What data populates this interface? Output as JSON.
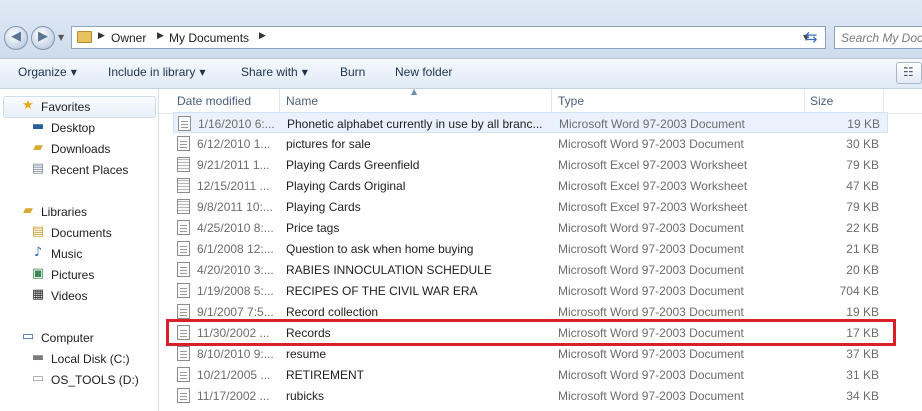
{
  "address_bar": {
    "breadcrumb": [
      "Owner",
      "My Documents"
    ],
    "search_placeholder": "Search My Documents"
  },
  "toolbar": {
    "organize": "Organize",
    "include_in_library": "Include in library",
    "share_with": "Share with",
    "burn": "Burn",
    "new_folder": "New folder"
  },
  "nav": {
    "favorites": {
      "header": "Favorites",
      "items": [
        "Desktop",
        "Downloads",
        "Recent Places"
      ]
    },
    "libraries": {
      "header": "Libraries",
      "items": [
        "Documents",
        "Music",
        "Pictures",
        "Videos"
      ]
    },
    "computer": {
      "header": "Computer",
      "items": [
        "Local Disk (C:)",
        "OS_TOOLS (D:)"
      ]
    }
  },
  "columns": [
    "Date modified",
    "Name",
    "Type",
    "Size"
  ],
  "files": [
    {
      "date": "1/16/2010 6:...",
      "name": "Phonetic alphabet currently in use by all branc...",
      "type": "Microsoft Word 97-2003 Document",
      "size": "19 KB",
      "icon": "word-doc-icon"
    },
    {
      "date": "6/12/2010 1...",
      "name": "pictures for sale",
      "type": "Microsoft Word 97-2003 Document",
      "size": "30 KB",
      "icon": "word-doc-icon"
    },
    {
      "date": "9/21/2011 1...",
      "name": "Playing Cards Greenfield",
      "type": "Microsoft Excel 97-2003 Worksheet",
      "size": "79 KB",
      "icon": "excel-sheet-icon"
    },
    {
      "date": "12/15/2011 ...",
      "name": "Playing Cards Original",
      "type": "Microsoft Excel 97-2003 Worksheet",
      "size": "47 KB",
      "icon": "excel-sheet-icon"
    },
    {
      "date": "9/8/2011 10:...",
      "name": "Playing Cards",
      "type": "Microsoft Excel 97-2003 Worksheet",
      "size": "79 KB",
      "icon": "excel-sheet-icon"
    },
    {
      "date": "4/25/2010 8:...",
      "name": "Price tags",
      "type": "Microsoft Word 97-2003 Document",
      "size": "22 KB",
      "icon": "word-doc-icon"
    },
    {
      "date": "6/1/2008 12:...",
      "name": "Question to ask when home buying",
      "type": "Microsoft Word 97-2003 Document",
      "size": "21 KB",
      "icon": "word-doc-icon"
    },
    {
      "date": "4/20/2010 3:...",
      "name": "RABIES INNOCULATION SCHEDULE",
      "type": "Microsoft Word 97-2003 Document",
      "size": "20 KB",
      "icon": "word-doc-icon"
    },
    {
      "date": "1/19/2008 5:...",
      "name": "RECIPES OF THE CIVIL WAR ERA",
      "type": "Microsoft Word 97-2003 Document",
      "size": "704 KB",
      "icon": "word-doc-icon"
    },
    {
      "date": "9/1/2007 7:5...",
      "name": "Record collection",
      "type": "Microsoft Word 97-2003 Document",
      "size": "19 KB",
      "icon": "word-doc-icon"
    },
    {
      "date": "11/30/2002 ...",
      "name": "Records",
      "type": "Microsoft Word 97-2003 Document",
      "size": "17 KB",
      "icon": "word-doc-icon"
    },
    {
      "date": "8/10/2010 9:...",
      "name": "resume",
      "type": "Microsoft Word 97-2003 Document",
      "size": "37 KB",
      "icon": "word-doc-icon"
    },
    {
      "date": "10/21/2005 ...",
      "name": "RETIREMENT",
      "type": "Microsoft Word 97-2003 Document",
      "size": "31 KB",
      "icon": "word-doc-icon"
    },
    {
      "date": "11/17/2002 ...",
      "name": "rubicks",
      "type": "Microsoft Word 97-2003 Document",
      "size": "34 KB",
      "icon": "word-doc-icon"
    }
  ],
  "colors": {
    "highlight": "#d8202b",
    "selection": "#e9f2fc"
  }
}
